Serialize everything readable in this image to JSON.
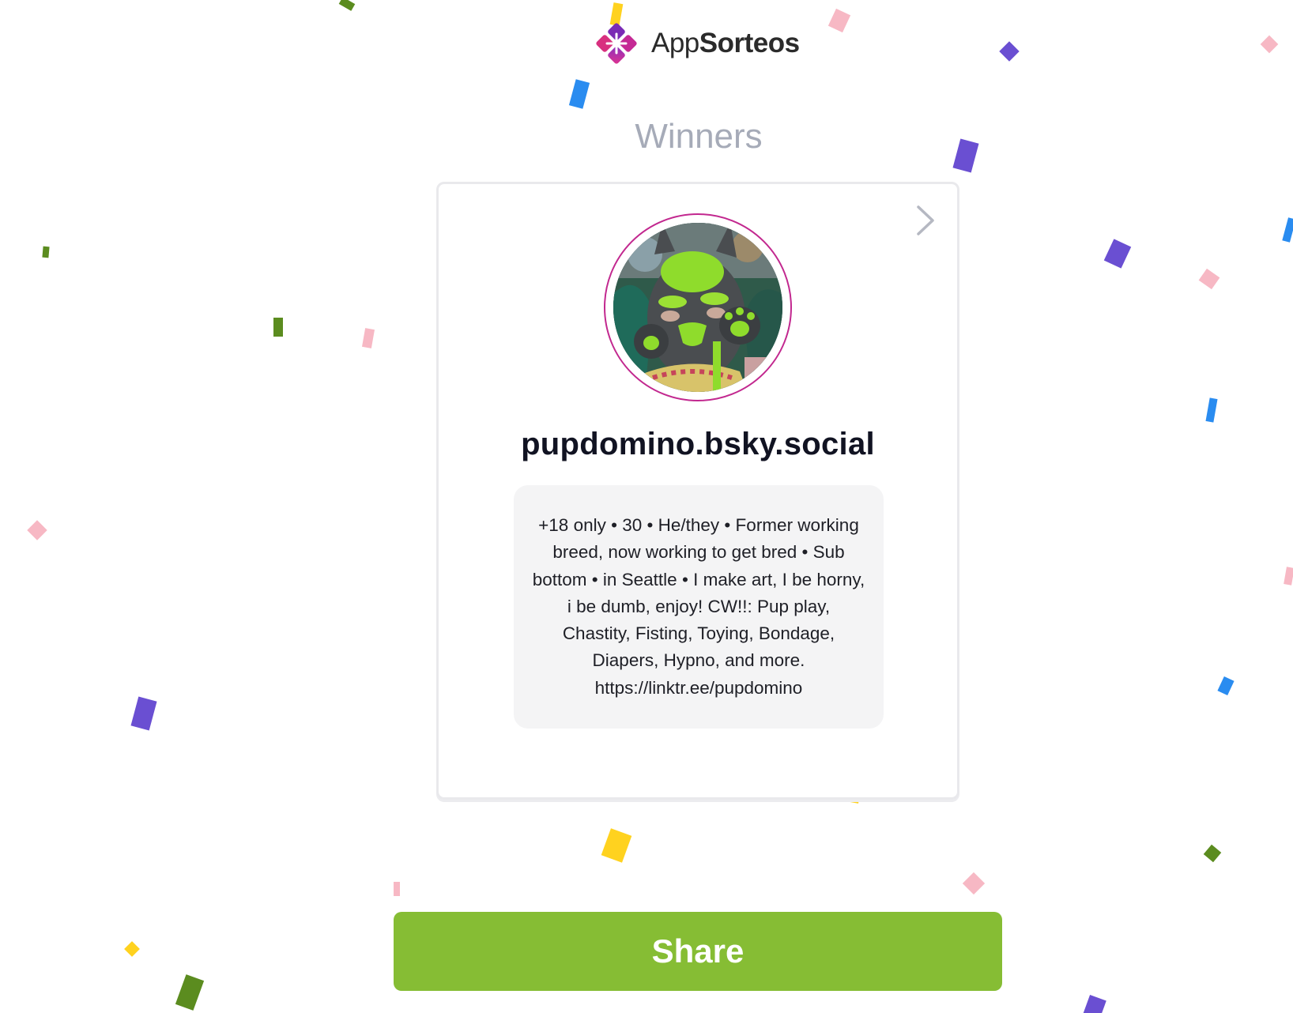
{
  "header": {
    "logo_text_regular": "App",
    "logo_text_bold": "Sorteos"
  },
  "page": {
    "title": "Winners"
  },
  "winner": {
    "handle": "pupdomino.bsky.social",
    "bio": "+18 only • 30 • He/they • Former working breed, now working to get bred • Sub bottom • in Seattle • I make art, I be horny, i be dumb, enjoy! CW!!: Pup play, Chastity, Fisting, Toying, Bondage, Diapers, Hypno, and more. https://linktr.ee/pupdomino"
  },
  "actions": {
    "share_label": "Share"
  },
  "icons": {
    "logo": "appsorteos-logo-icon",
    "next": "chevron-right-icon",
    "avatar": "avatar"
  },
  "colors": {
    "brand_magenta": "#c2288f",
    "brand_purple": "#7a2bb5",
    "share_green": "#86bd34",
    "title_gray": "#a6abb8",
    "confetti": [
      "#6a4fd2",
      "#2a8cf0",
      "#ffd21f",
      "#f7b8c4",
      "#5b8c1f"
    ]
  }
}
